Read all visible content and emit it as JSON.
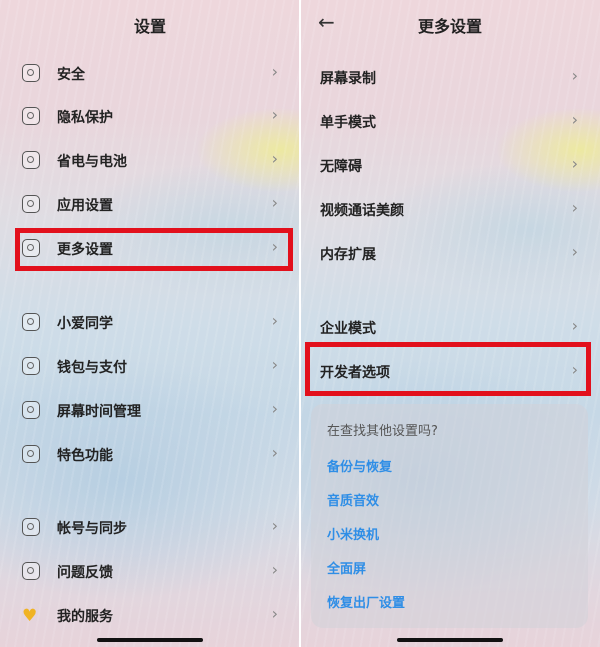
{
  "left": {
    "title": "设置",
    "items": [
      {
        "label": "安全",
        "icon": "shield-icon"
      },
      {
        "label": "隐私保护",
        "icon": "privacy-icon"
      },
      {
        "label": "省电与电池",
        "icon": "battery-icon"
      },
      {
        "label": "应用设置",
        "icon": "apps-icon"
      },
      {
        "label": "更多设置",
        "icon": "more-icon"
      },
      {
        "label": "小爱同学",
        "icon": "xiaoai-icon"
      },
      {
        "label": "钱包与支付",
        "icon": "wallet-icon"
      },
      {
        "label": "屏幕时间管理",
        "icon": "hourglass-icon"
      },
      {
        "label": "特色功能",
        "icon": "drop-icon"
      },
      {
        "label": "帐号与同步",
        "icon": "account-icon"
      },
      {
        "label": "问题反馈",
        "icon": "feedback-icon"
      },
      {
        "label": "我的服务",
        "icon": "heart-icon"
      }
    ]
  },
  "right": {
    "title": "更多设置",
    "back_icon": "back-arrow-icon",
    "items": [
      {
        "label": "屏幕录制"
      },
      {
        "label": "单手模式"
      },
      {
        "label": "无障碍"
      },
      {
        "label": "视频通话美颜"
      },
      {
        "label": "内存扩展"
      },
      {
        "label": "企业模式"
      },
      {
        "label": "开发者选项"
      }
    ],
    "suggest": {
      "question": "在查找其他设置吗?",
      "links": [
        "备份与恢复",
        "音质音效",
        "小米换机",
        "全面屏",
        "恢复出厂设置"
      ]
    }
  },
  "colors": {
    "highlight": "#e2101c",
    "link": "#2f8ee6"
  }
}
